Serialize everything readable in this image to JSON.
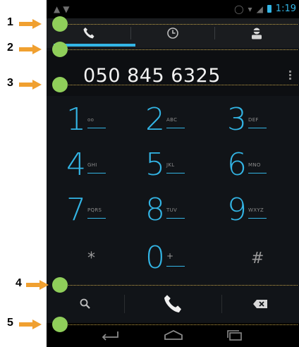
{
  "dialer": {
    "number": "050 845 6325",
    "tabs": [
      {
        "name": "phone",
        "icon": "phone-tab-icon"
      },
      {
        "name": "recent",
        "icon": "clock-icon"
      },
      {
        "name": "contacts",
        "icon": "contacts-icon"
      }
    ],
    "keys": [
      {
        "digit": "1",
        "letters": "oo"
      },
      {
        "digit": "2",
        "letters": "ABC"
      },
      {
        "digit": "3",
        "letters": "DEF"
      },
      {
        "digit": "4",
        "letters": "GHI"
      },
      {
        "digit": "5",
        "letters": "JKL"
      },
      {
        "digit": "6",
        "letters": "MNO"
      },
      {
        "digit": "7",
        "letters": "PQRS"
      },
      {
        "digit": "8",
        "letters": "TUV"
      },
      {
        "digit": "9",
        "letters": "WXYZ"
      },
      {
        "digit": "*",
        "letters": ""
      },
      {
        "digit": "0",
        "letters": "+"
      },
      {
        "digit": "#",
        "letters": ""
      }
    ]
  },
  "status_bar": {
    "time": "1:19"
  },
  "annotations": [
    "1",
    "2",
    "3",
    "4",
    "5"
  ],
  "colors": {
    "accent": "#33b5e5",
    "background": "#111418",
    "callout": "#8fce5a",
    "arrow": "#f0a030"
  }
}
